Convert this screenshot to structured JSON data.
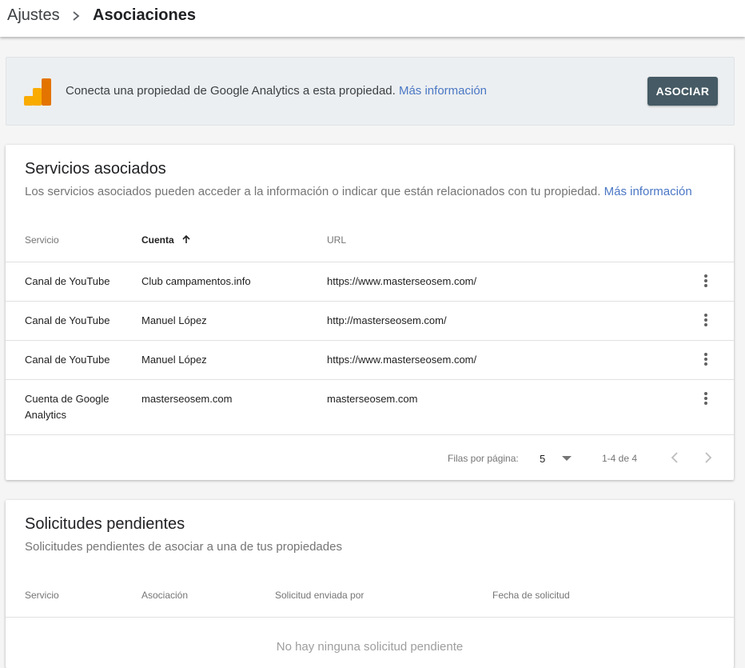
{
  "breadcrumb": {
    "root": "Ajustes",
    "current": "Asociaciones"
  },
  "banner": {
    "text": "Conecta una propiedad de Google Analytics a esta propiedad.",
    "link": "Más información",
    "button": "ASOCIAR",
    "icon": "google-analytics-logo-icon"
  },
  "linked_services": {
    "title": "Servicios asociados",
    "subtitle": "Los servicios asociados pueden acceder a la información o indicar que están relacionados con tu propiedad.",
    "subtitle_link": "Más información",
    "columns": {
      "service": "Servicio",
      "account": "Cuenta",
      "url": "URL"
    },
    "rows": [
      {
        "service": "Canal de YouTube",
        "service2": "",
        "account": "Club campamentos.info",
        "url": "https://www.masterseosem.com/"
      },
      {
        "service": "Canal de YouTube",
        "service2": "",
        "account": "Manuel López",
        "url": "http://masterseosem.com/"
      },
      {
        "service": "Canal de YouTube",
        "service2": "",
        "account": "Manuel López",
        "url": "https://www.masterseosem.com/"
      },
      {
        "service": "Cuenta de Google",
        "service2": "Analytics",
        "account": "masterseosem.com",
        "url": "masterseosem.com"
      }
    ],
    "pagination": {
      "rows_label": "Filas por página:",
      "rows_value": "5",
      "range": "1-4 de 4"
    }
  },
  "pending_requests": {
    "title": "Solicitudes pendientes",
    "subtitle": "Solicitudes pendientes de asociar a una de tus propiedades",
    "columns": {
      "service": "Servicio",
      "association": "Asociación",
      "sent_by": "Solicitud enviada por",
      "date": "Fecha de solicitud"
    },
    "empty": "No hay ninguna solicitud pendiente"
  },
  "colors": {
    "accent_link": "#4a77c4",
    "button_bg": "#455a64",
    "ga_orange": "#f9ab00",
    "ga_dark_orange": "#e37400"
  }
}
